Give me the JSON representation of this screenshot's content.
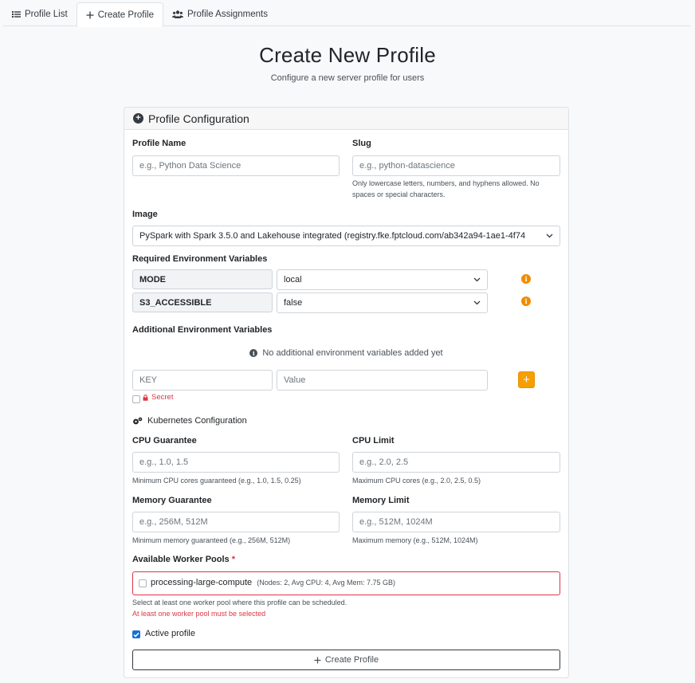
{
  "tabs": [
    {
      "label": "Profile List",
      "icon": "list-icon"
    },
    {
      "label": "Create Profile",
      "icon": "plus-icon"
    },
    {
      "label": "Profile Assignments",
      "icon": "users-icon"
    }
  ],
  "page": {
    "title": "Create New Profile",
    "subtitle": "Configure a new server profile for users"
  },
  "card": {
    "header": "Profile Configuration"
  },
  "form": {
    "profile_name_label": "Profile Name",
    "profile_name_placeholder": "e.g., Python Data Science",
    "slug_label": "Slug",
    "slug_placeholder": "e.g., python-datascience",
    "slug_help": "Only lowercase letters, numbers, and hyphens allowed. No spaces or special characters.",
    "image_label": "Image",
    "image_value": "PySpark with Spark 3.5.0 and Lakehouse integrated (registry.fke.fptcloud.com/ab342a94-1ae1-4f74",
    "required_env_label": "Required Environment Variables",
    "required_env": [
      {
        "key": "MODE",
        "value": "local"
      },
      {
        "key": "S3_ACCESSIBLE",
        "value": "false"
      }
    ],
    "additional_env_label": "Additional Environment Variables",
    "no_env_message": "No additional environment variables added yet",
    "key_placeholder": "KEY",
    "value_placeholder": "Value",
    "secret_label": "Secret",
    "k8s_label": "Kubernetes Configuration",
    "cpu_guarantee_label": "CPU Guarantee",
    "cpu_guarantee_placeholder": "e.g., 1.0, 1.5",
    "cpu_guarantee_help": "Minimum CPU cores guaranteed (e.g., 1.0, 1.5, 0.25)",
    "cpu_limit_label": "CPU Limit",
    "cpu_limit_placeholder": "e.g., 2.0, 2.5",
    "cpu_limit_help": "Maximum CPU cores (e.g., 2.0, 2.5, 0.5)",
    "mem_guarantee_label": "Memory Guarantee",
    "mem_guarantee_placeholder": "e.g., 256M, 512M",
    "mem_guarantee_help": "Minimum memory guaranteed (e.g., 256M, 512M)",
    "mem_limit_label": "Memory Limit",
    "mem_limit_placeholder": "e.g., 512M, 1024M",
    "mem_limit_help": "Maximum memory (e.g., 512M, 1024M)",
    "worker_pools_label": "Available Worker Pools",
    "required_mark": "*",
    "pool_name": "processing-large-compute",
    "pool_details": "(Nodes: 2, Avg CPU: 4, Avg Mem: 7.75 GB)",
    "pool_help": "Select at least one worker pool where this profile can be scheduled.",
    "pool_error": "At least one worker pool must be selected",
    "active_label": "Active profile",
    "active_checked": true,
    "submit_label": "Create Profile"
  },
  "colors": {
    "accent": "#f59f00",
    "info_icon": "#f08c00",
    "error": "#dc3545",
    "checkbox": "#1c6ed6"
  }
}
